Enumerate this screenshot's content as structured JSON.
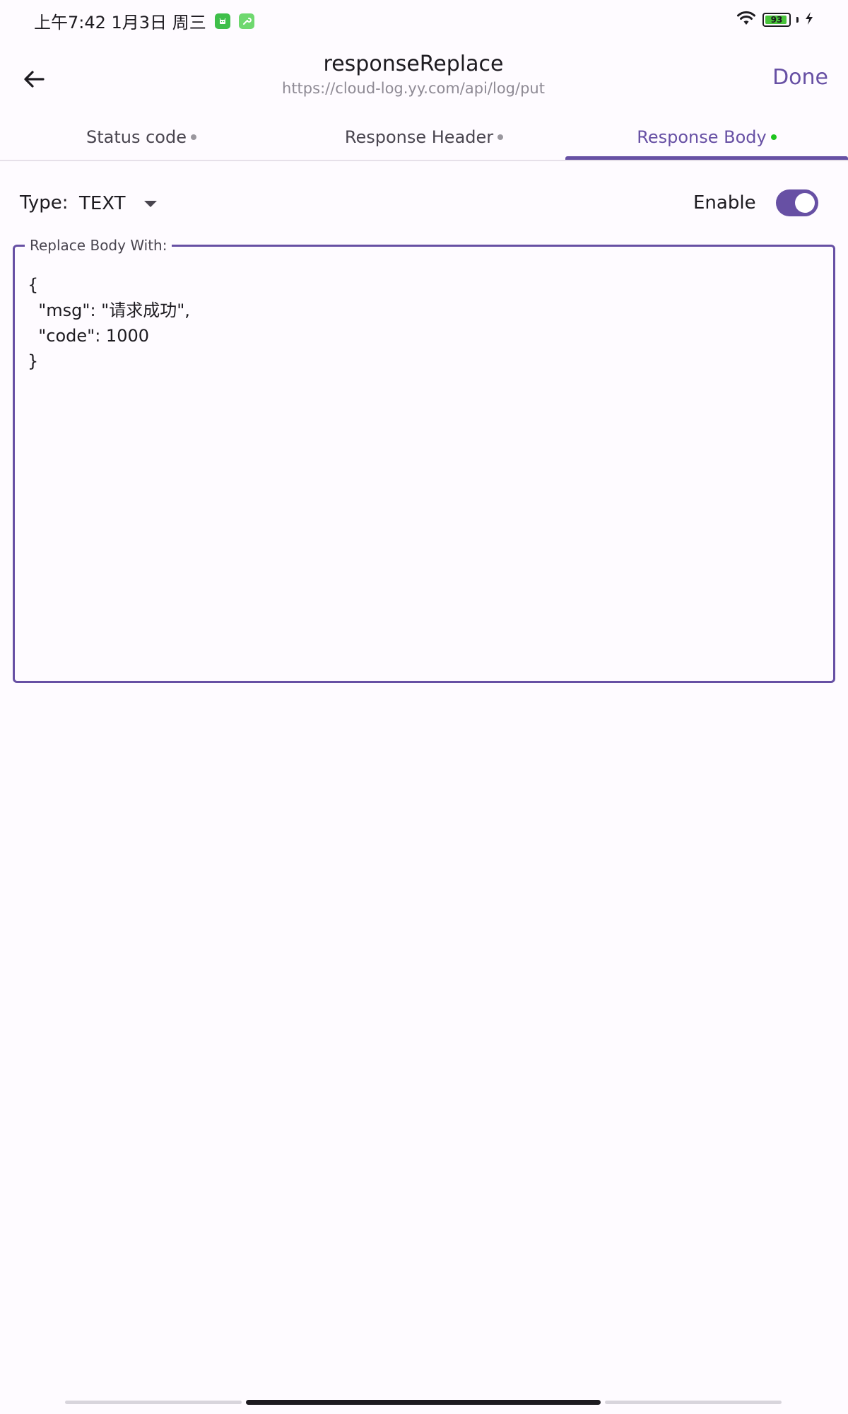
{
  "status_bar": {
    "time": "上午7:42 1月3日 周三",
    "battery_level": "93",
    "icons": [
      "android-icon",
      "tool-icon",
      "wifi-icon",
      "battery-icon",
      "charging-icon"
    ]
  },
  "header": {
    "title": "responseReplace",
    "subtitle": "https://cloud-log.yy.com/api/log/put",
    "done_label": "Done",
    "back_icon": "arrow-back-icon"
  },
  "tabs": [
    {
      "label": "Status code",
      "active": false
    },
    {
      "label": "Response Header",
      "active": false
    },
    {
      "label": "Response Body",
      "active": true
    }
  ],
  "controls": {
    "type_label": "Type:",
    "type_value": "TEXT",
    "enable_label": "Enable",
    "enabled": true
  },
  "body_field": {
    "label": "Replace Body With:",
    "value": "{\n  \"msg\": \"请求成功\",\n  \"code\": 1000\n}"
  },
  "colors": {
    "accent": "#6750a4",
    "background": "#fefbff",
    "active_dot": "#1ec41e",
    "inactive_dot": "#9a979e"
  }
}
